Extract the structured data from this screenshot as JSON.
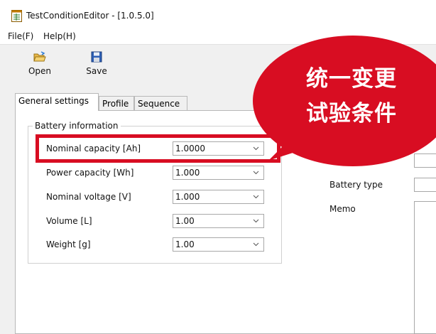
{
  "window": {
    "title": "TestConditionEditor - [1.0.5.0]"
  },
  "menu": [
    {
      "label": "File(F)"
    },
    {
      "label": "Help(H)"
    }
  ],
  "toolbar": {
    "open_label": "Open",
    "save_label": "Save"
  },
  "tabs": [
    {
      "label": "General settings",
      "active": true
    },
    {
      "label": "Profile",
      "active": false
    },
    {
      "label": "Sequence",
      "active": false
    }
  ],
  "battery_info": {
    "title": "Battery information",
    "fields": [
      {
        "label": "Nominal capacity [Ah]",
        "value": "1.0000"
      },
      {
        "label": "Power capacity [Wh]",
        "value": "1.000"
      },
      {
        "label": "Nominal voltage [V]",
        "value": "1.000"
      },
      {
        "label": "Volume [L]",
        "value": "1.00"
      },
      {
        "label": "Weight [g]",
        "value": "1.00"
      }
    ]
  },
  "right_panel": {
    "battery_type_label": "Battery type",
    "memo_label": "Memo"
  },
  "callout": {
    "line1": "统一变更",
    "line2": "试验条件",
    "color": "#d80d22"
  }
}
